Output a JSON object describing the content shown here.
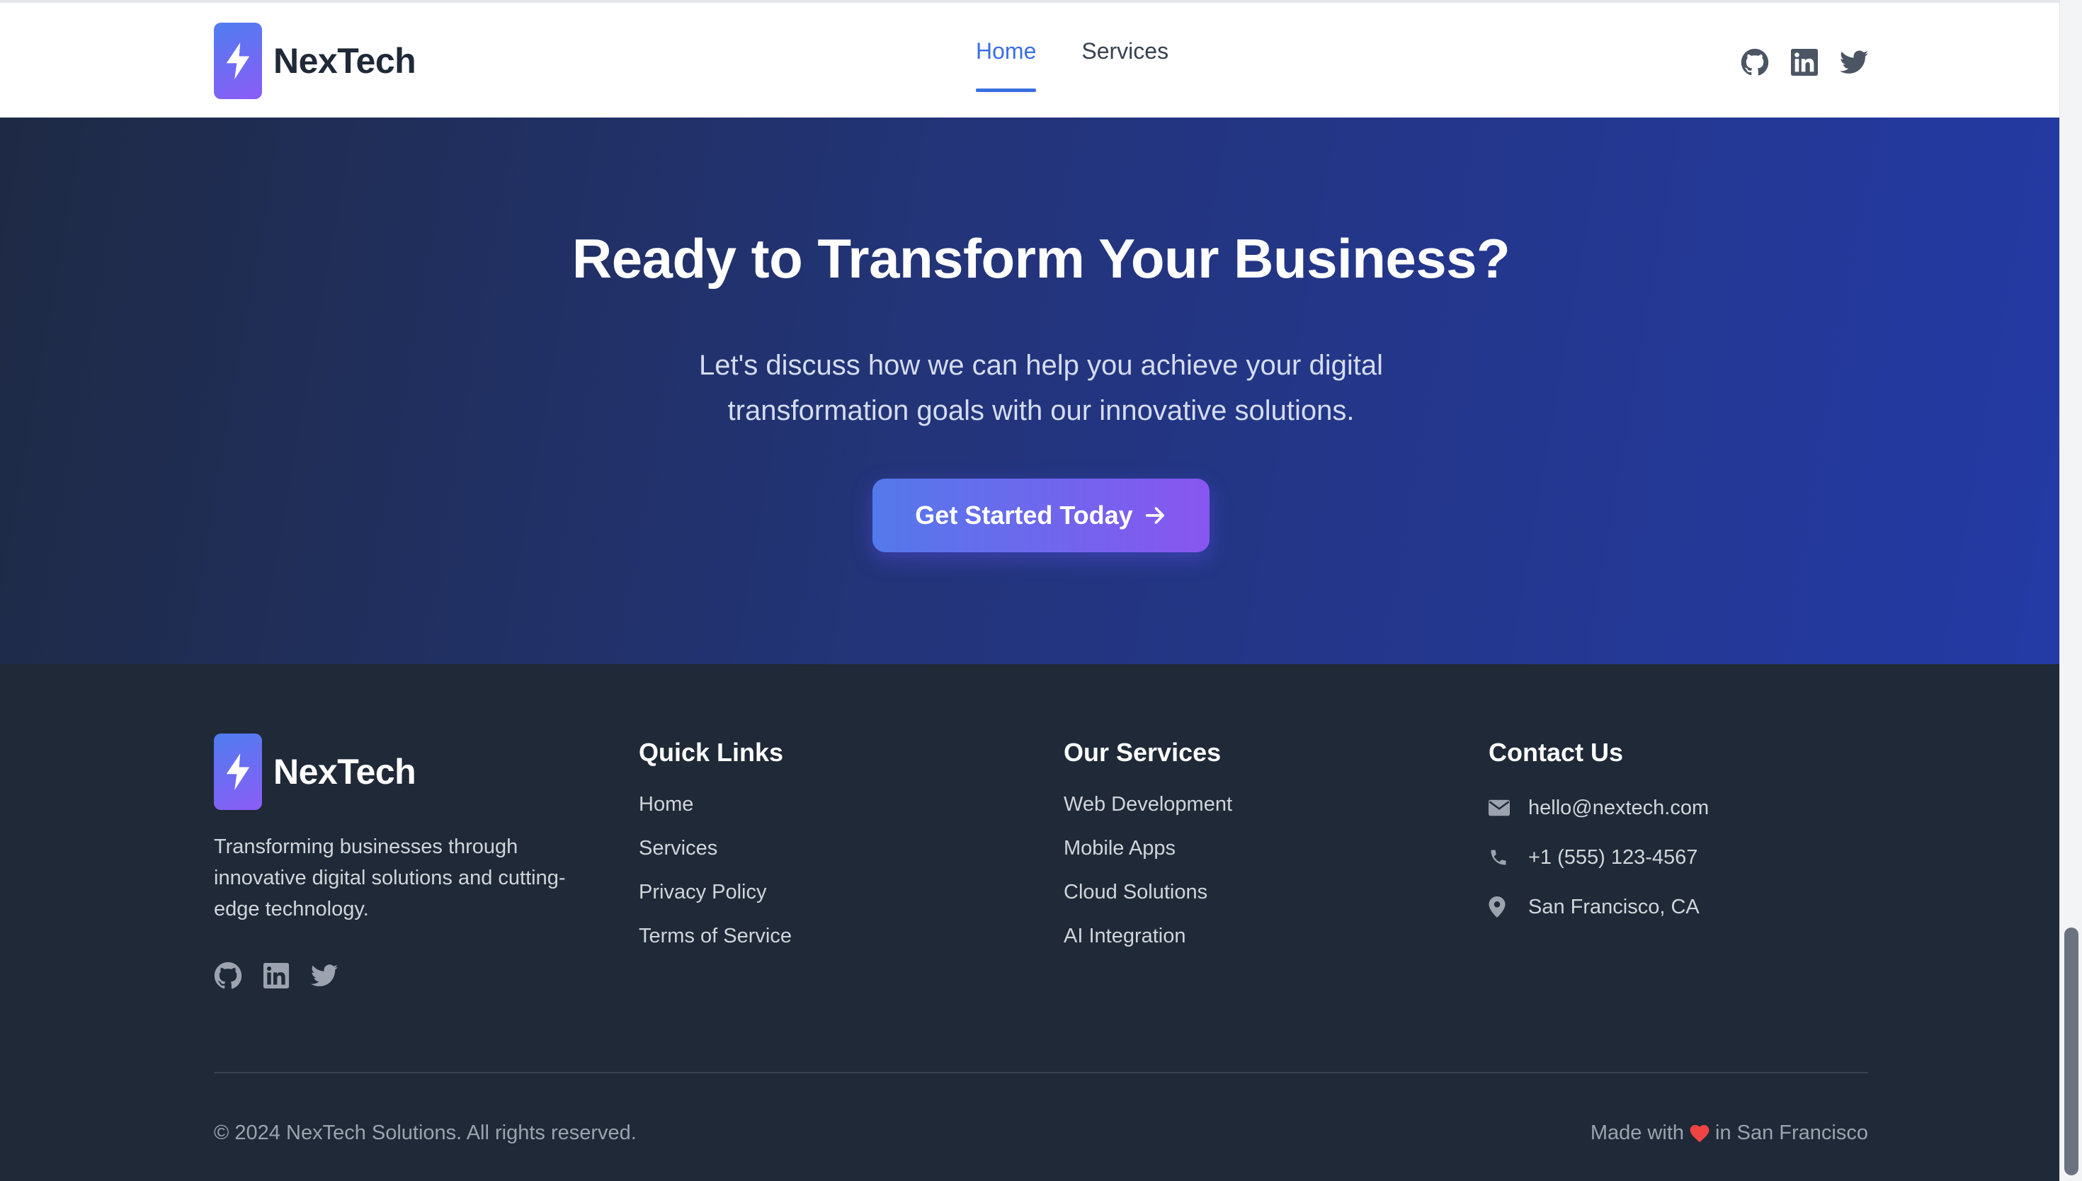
{
  "brand": {
    "name": "NexTech"
  },
  "nav": {
    "items": [
      "Home",
      "Services"
    ],
    "active": "Home"
  },
  "hero": {
    "title": "Ready to Transform Your Business?",
    "subtitle": "Let's discuss how we can help you achieve your digital transformation goals with our innovative solutions.",
    "cta_label": "Get Started Today"
  },
  "footer": {
    "tagline": "Transforming businesses through innovative digital solutions and cutting-edge technology.",
    "quick_links": {
      "title": "Quick Links",
      "items": [
        "Home",
        "Services",
        "Privacy Policy",
        "Terms of Service"
      ]
    },
    "services": {
      "title": "Our Services",
      "items": [
        "Web Development",
        "Mobile Apps",
        "Cloud Solutions",
        "AI Integration"
      ]
    },
    "contact": {
      "title": "Contact Us",
      "email": "hello@nextech.com",
      "phone": "+1 (555) 123-4567",
      "location": "San Francisco, CA"
    },
    "copyright": "© 2024 NexTech Solutions. All rights reserved.",
    "made_with_prefix": "Made with",
    "made_with_suffix": "in San Francisco"
  },
  "social_icons": [
    "github-icon",
    "linkedin-icon",
    "twitter-icon"
  ],
  "colors": {
    "accent": "#3b6fe0",
    "gradient_start": "#4f7df0",
    "gradient_end": "#8b5cf6",
    "footer_bg": "#1f2937",
    "hero_bg": "#233479"
  }
}
